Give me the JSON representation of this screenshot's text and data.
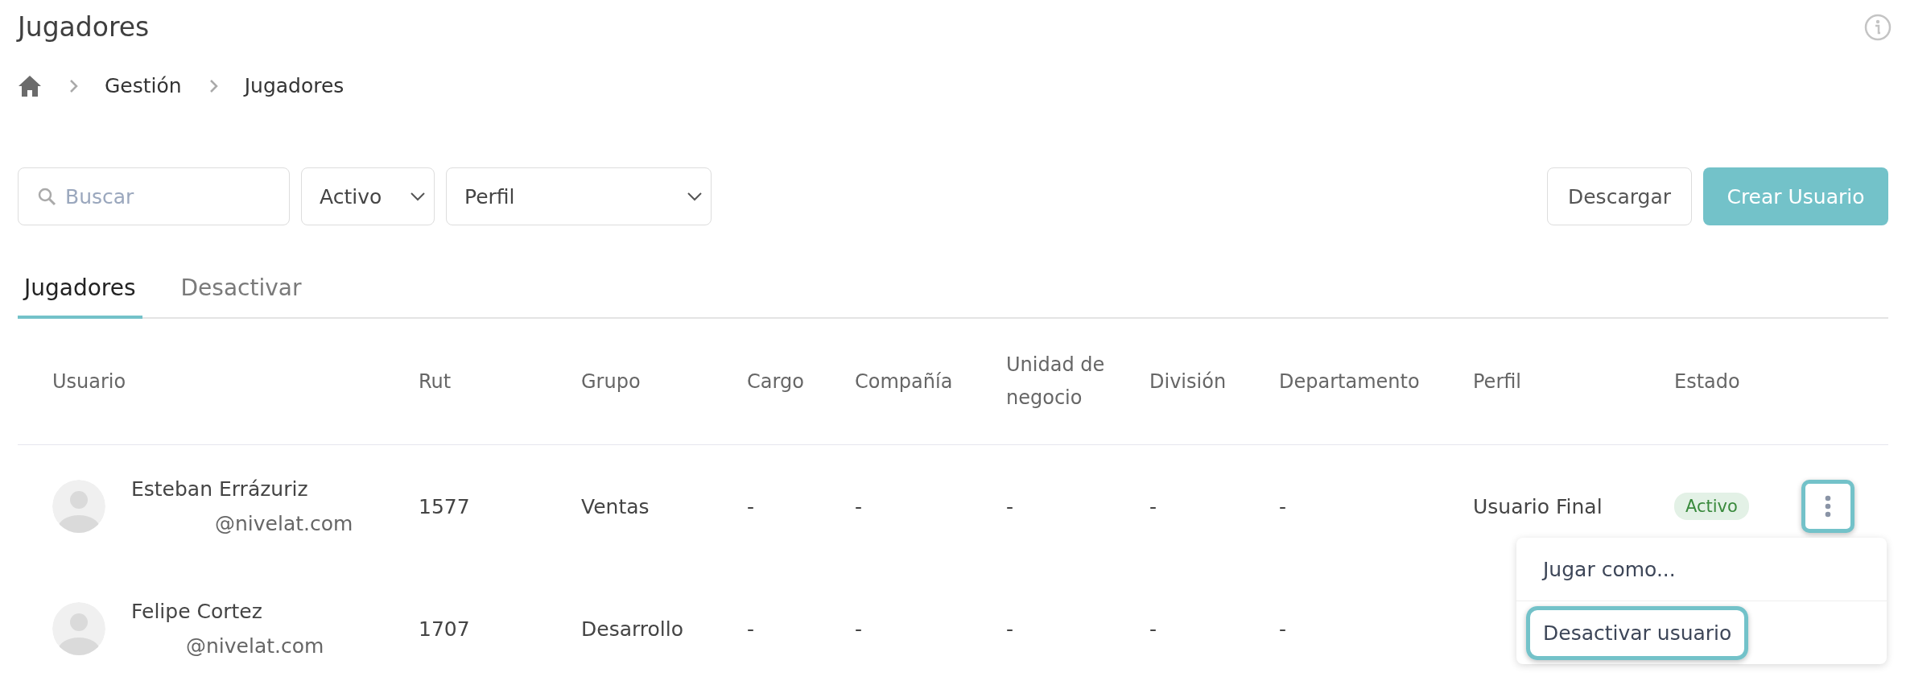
{
  "page": {
    "title": "Jugadores"
  },
  "breadcrumb": [
    "Gestión",
    "Jugadores"
  ],
  "filters": {
    "search": {
      "placeholder": "Buscar"
    },
    "status": {
      "value": "Activo"
    },
    "profile": {
      "value": "Perfil"
    }
  },
  "actions": [
    {
      "label": "Descargar",
      "kind": "secondary"
    },
    {
      "label": "Crear Usuario",
      "kind": "primary"
    }
  ],
  "tabs": [
    {
      "label": "Jugadores",
      "selected": true
    },
    {
      "label": "Desactivar",
      "selected": false
    }
  ],
  "table": {
    "columns": [
      "Usuario",
      "Rut",
      "Grupo",
      "Cargo",
      "Compañía",
      "Unidad de negocio",
      "División",
      "Departamento",
      "Perfil",
      "Estado"
    ],
    "rows": [
      {
        "name": "Esteban Errázuriz",
        "email": "@nivelat.com",
        "rut": "1577",
        "grupo": "Ventas",
        "cargo": "-",
        "compania": "-",
        "unidad": "-",
        "division": "-",
        "departamento": "-",
        "perfil": "Usuario Final",
        "estado": "Activo",
        "menu_open": true
      },
      {
        "name": "Felipe Cortez",
        "email": "@nivelat.com",
        "rut": "1707",
        "grupo": "Desarrollo",
        "cargo": "-",
        "compania": "-",
        "unidad": "-",
        "division": "-",
        "departamento": "-",
        "menu_open": false
      }
    ]
  },
  "row_menu": [
    {
      "label": "Jugar como...",
      "highlighted": false
    },
    {
      "label": "Desactivar usuario",
      "highlighted": true
    }
  ]
}
